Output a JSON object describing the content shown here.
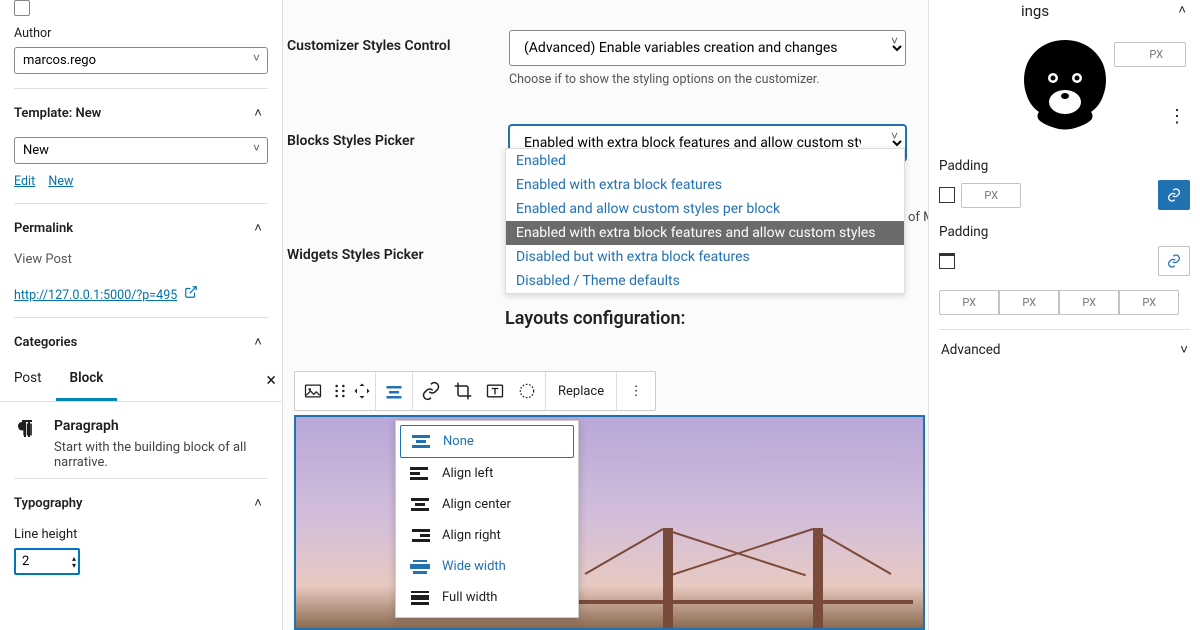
{
  "left": {
    "author_label": "Author",
    "author_value": "marcos.rego",
    "template_label": "Template: New",
    "template_value": "New",
    "edit": "Edit",
    "new": "New",
    "permalink_label": "Permalink",
    "view_post": "View Post",
    "url": "http://127.0.0.1:5000/?p=495",
    "categories_label": "Categories",
    "tab_post": "Post",
    "tab_block": "Block",
    "para_title": "Paragraph",
    "para_desc": "Start with the building block of all narrative.",
    "typography_label": "Typography",
    "line_height_label": "Line height",
    "line_height_value": "2"
  },
  "mid": {
    "csc_label": "Customizer Styles Control",
    "csc_value": "(Advanced) Enable variables creation and changes",
    "csc_help": "Choose if to show the styling options on the customizer.",
    "bsp_label": "Blocks Styles Picker",
    "bsp_value": "Enabled with extra block features and allow custom styles",
    "wsp_label": "Widgets Styles Picker",
    "wsp_help": "Choose if to show Mr.Dev.'s styles picker on widgets.",
    "layouts_heading": "Layouts configuration:",
    "dd": [
      "Enabled",
      "Enabled with extra block features",
      "Enabled and allow custom styles per block",
      "Enabled with extra block features and allow custom styles",
      "Disabled but with extra block features",
      "Disabled / Theme defaults"
    ],
    "of_m": "of M",
    "replace": "Replace",
    "align": {
      "none": "None",
      "left": "Align left",
      "center": "Align center",
      "right": "Align right",
      "wide": "Wide width",
      "full": "Full width"
    }
  },
  "right": {
    "ings": "ings",
    "px": "PX",
    "padding": "Padding",
    "advanced": "Advanced"
  }
}
